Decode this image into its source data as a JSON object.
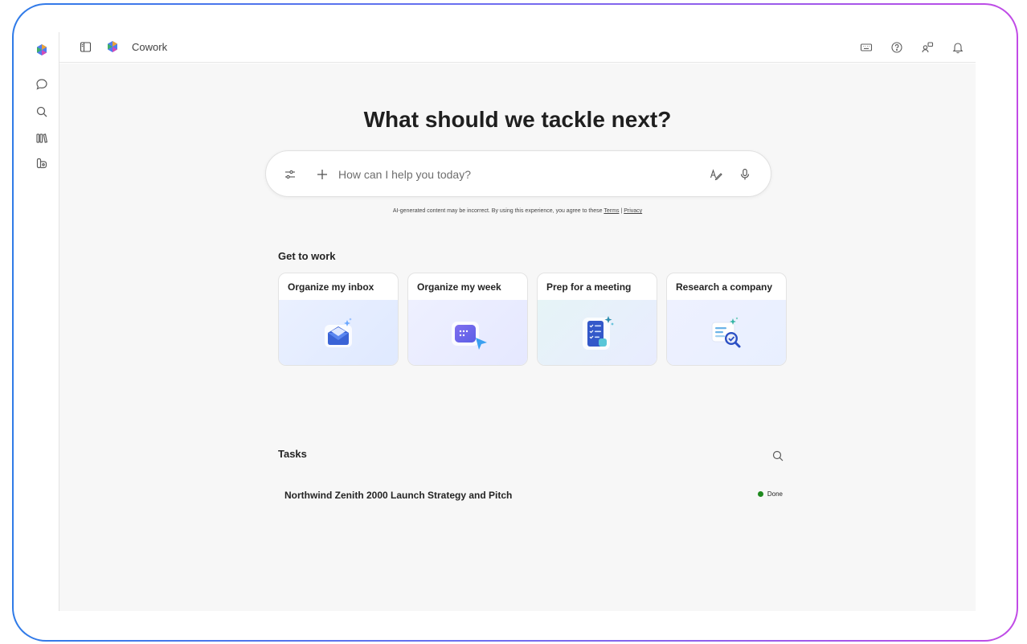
{
  "app": {
    "title": "Cowork"
  },
  "topbar": {
    "icons": [
      "sidebar-toggle-icon",
      "copilot-logo-icon",
      "keyboard-icon",
      "help-icon",
      "people-icon",
      "bell-icon"
    ]
  },
  "rail": {
    "items": [
      "copilot-logo-icon",
      "chat-icon",
      "search-icon",
      "library-icon",
      "agents-icon"
    ]
  },
  "main": {
    "headline": "What should we tackle next?",
    "prompt": {
      "placeholder": "How can I help you today?"
    },
    "disclaimer": {
      "text": "AI-generated content may be incorrect. By using this experience, you agree to these",
      "terms": "Terms",
      "separator": "|",
      "privacy": "Privacy"
    },
    "get_to_work": {
      "label": "Get to work",
      "cards": [
        {
          "title": "Organize my inbox",
          "icon": "envelope-icon"
        },
        {
          "title": "Organize my week",
          "icon": "calendar-cursor-icon"
        },
        {
          "title": "Prep for a meeting",
          "icon": "checklist-icon"
        },
        {
          "title": "Research a company",
          "icon": "document-magnifier-icon"
        }
      ]
    },
    "tasks": {
      "label": "Tasks",
      "items": [
        {
          "title": "Northwind Zenith 2000 Launch Strategy and Pitch",
          "status": "Done"
        }
      ]
    }
  },
  "colors": {
    "accent_start": "#2f7be8",
    "accent_end": "#c14be6",
    "done": "#1f8a1f"
  }
}
